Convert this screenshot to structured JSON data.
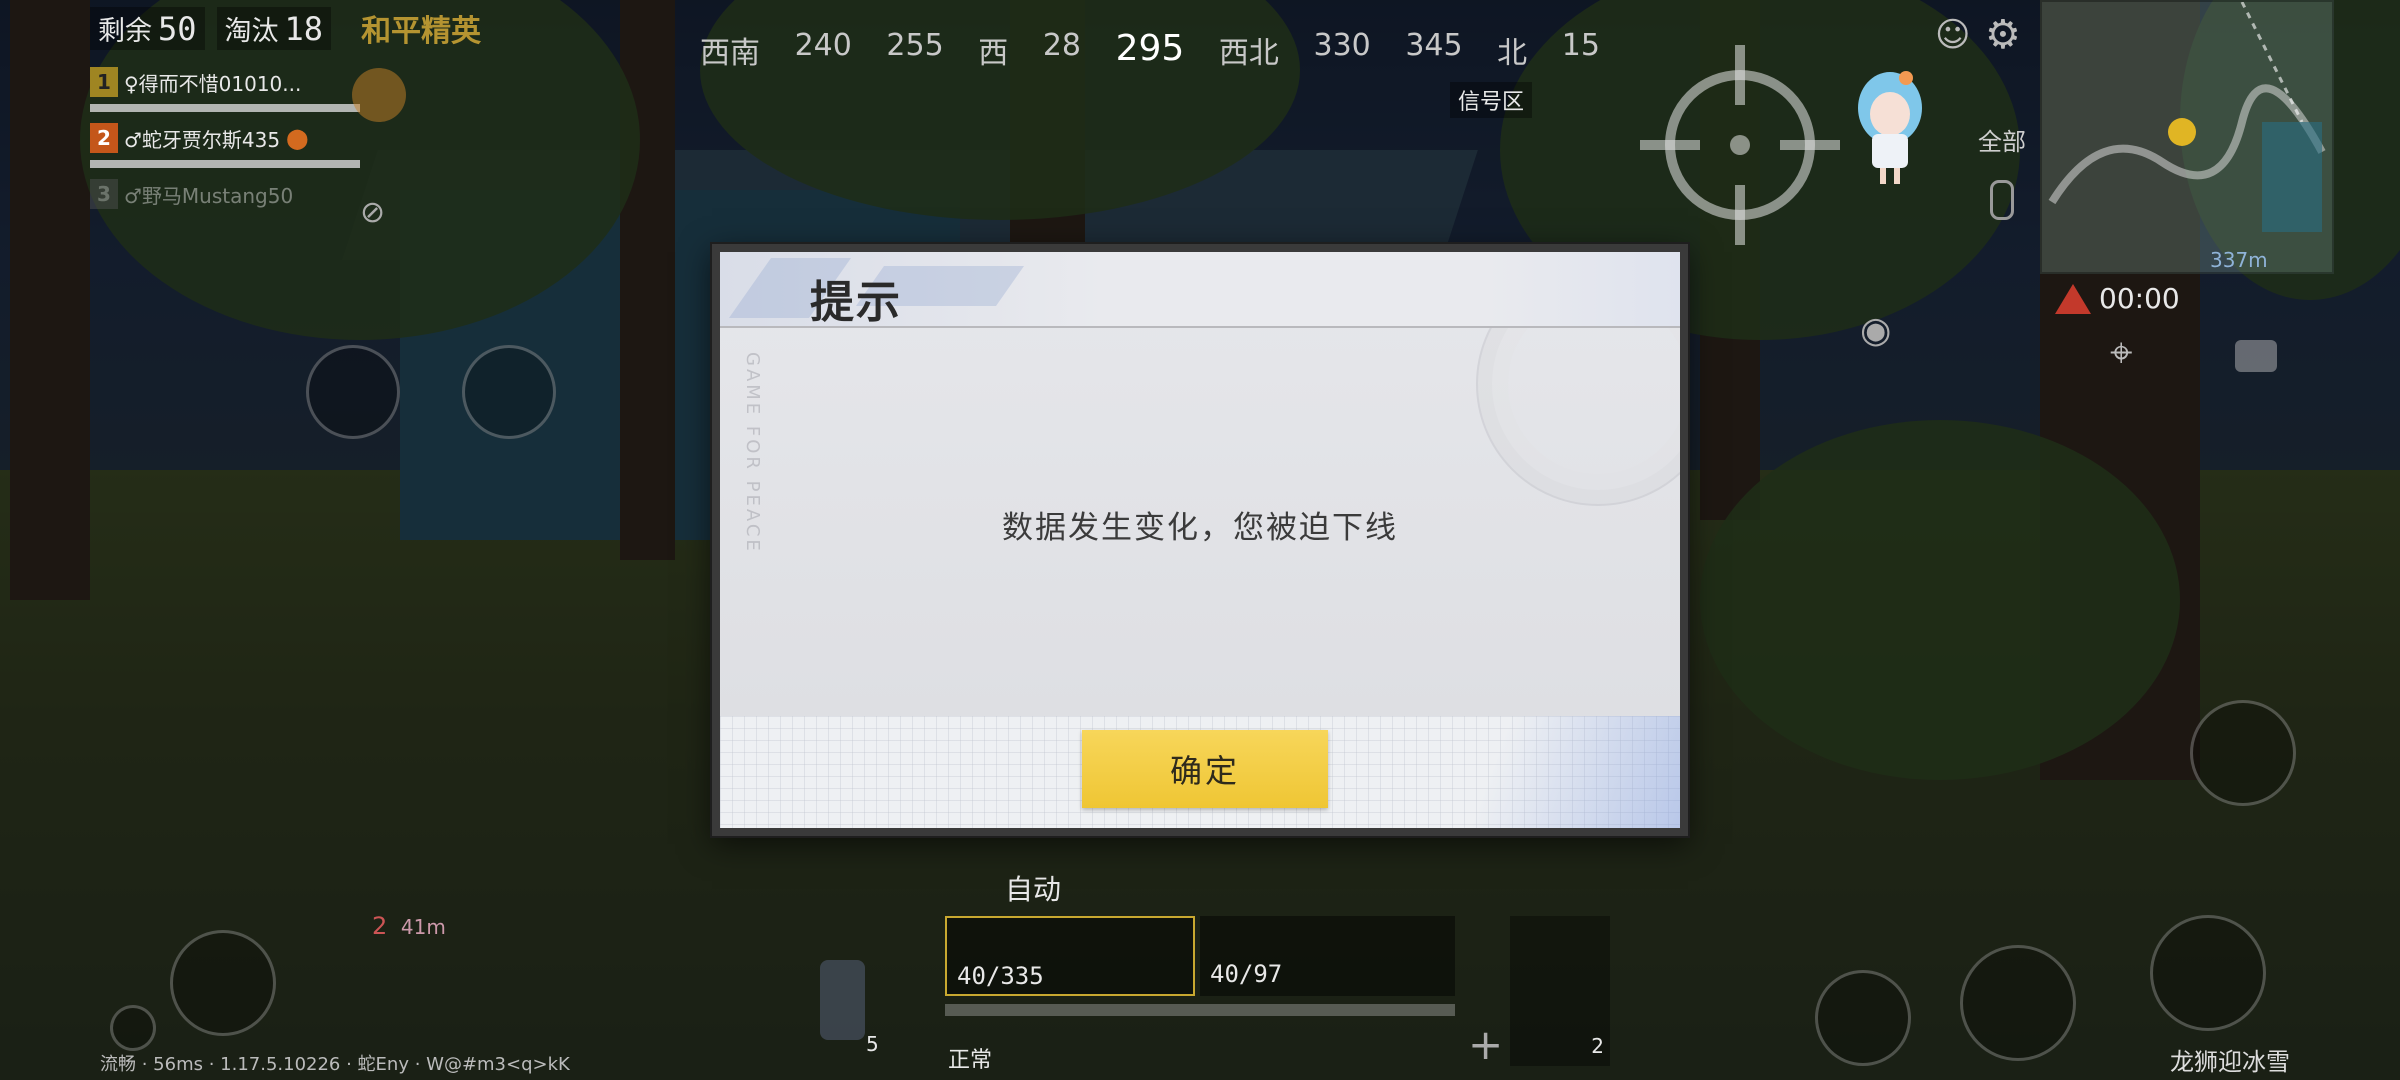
{
  "hud": {
    "remaining_label": "剩余",
    "remaining_count": "50",
    "eliminated_label": "淘汰",
    "eliminated_count": "18",
    "brand": "和平精英",
    "team": [
      {
        "num": "1",
        "name": "♀得而不惜01010..."
      },
      {
        "num": "2",
        "name": "♂蛇牙贾尔斯435"
      },
      {
        "num": "3",
        "name": "♂野马Mustang50"
      }
    ],
    "compass": [
      "西南",
      "240",
      "255",
      "西",
      "28",
      "295",
      "西北",
      "330",
      "345",
      "北",
      "15"
    ],
    "signal_zone": "信号区",
    "voice_all": "全部",
    "minimap_distance": "337m",
    "timer": "00:00",
    "fire_mode": "自动",
    "primary_ammo": "40/335",
    "secondary_ammo": "40/97",
    "item_count_left": "5",
    "grenade_count": "2",
    "state": "正常",
    "marker_number": "2",
    "marker_distance": "41m",
    "status_line": "流畅 · 56ms · 1.17.5.10226 · 蛇Eny · W@#m3<q>kK",
    "map_label": "龙狮迎冰雪"
  },
  "dialog": {
    "title": "提示",
    "message": "数据发生变化，您被迫下线",
    "confirm_label": "确定",
    "watermark": "GAME FOR PEACE"
  },
  "colors": {
    "confirm": "#f2ca3c",
    "dialog_bg": "#e1e2e6",
    "frame": "#3a3a3a"
  }
}
